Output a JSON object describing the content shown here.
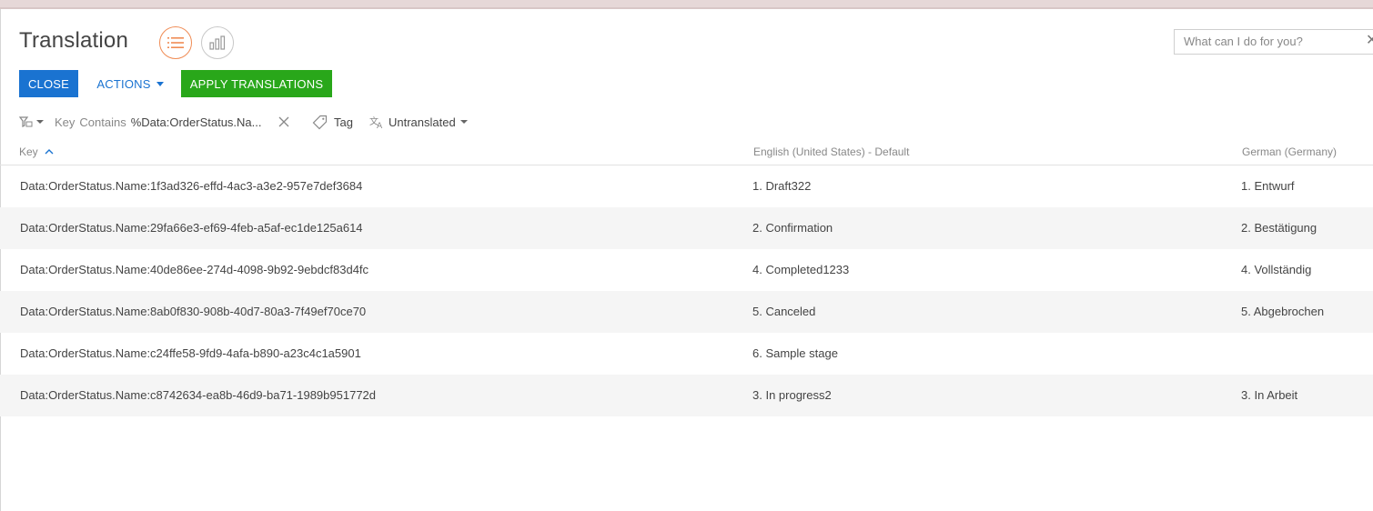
{
  "page": {
    "title": "Translation",
    "search_placeholder": "What can I do for you?"
  },
  "view_switcher": {
    "list_icon": "list-icon",
    "analytics_icon": "bar-chart-icon"
  },
  "toolbar": {
    "close_label": "CLOSE",
    "actions_label": "ACTIONS",
    "apply_label": "APPLY TRANSLATIONS",
    "close_color": "#1a73d1",
    "apply_color": "#29a71a"
  },
  "filter": {
    "field": "Key",
    "operator": "Contains",
    "value": "%Data:OrderStatus.Na...",
    "tag_label": "Tag",
    "status_label": "Untranslated"
  },
  "table": {
    "columns": {
      "key": "Key",
      "english": "English (United States) - Default",
      "german": "German (Germany)"
    },
    "rows": [
      {
        "key": "Data:OrderStatus.Name:1f3ad326-effd-4ac3-a3e2-957e7def3684",
        "english": "1. Draft322",
        "german": "1. Entwurf"
      },
      {
        "key": "Data:OrderStatus.Name:29fa66e3-ef69-4feb-a5af-ec1de125a614",
        "english": "2. Confirmation",
        "german": "2. Bestätigung"
      },
      {
        "key": "Data:OrderStatus.Name:40de86ee-274d-4098-9b92-9ebdcf83d4fc",
        "english": "4. Completed1233",
        "german": "4. Vollständig"
      },
      {
        "key": "Data:OrderStatus.Name:8ab0f830-908b-40d7-80a3-7f49ef70ce70",
        "english": "5. Canceled",
        "german": "5. Abgebrochen"
      },
      {
        "key": "Data:OrderStatus.Name:c24ffe58-9fd9-4afa-b890-a23c4c1a5901",
        "english": "6. Sample stage",
        "german": ""
      },
      {
        "key": "Data:OrderStatus.Name:c8742634-ea8b-46d9-ba71-1989b951772d",
        "english": "3. In progress2",
        "german": "3. In Arbeit"
      }
    ]
  }
}
